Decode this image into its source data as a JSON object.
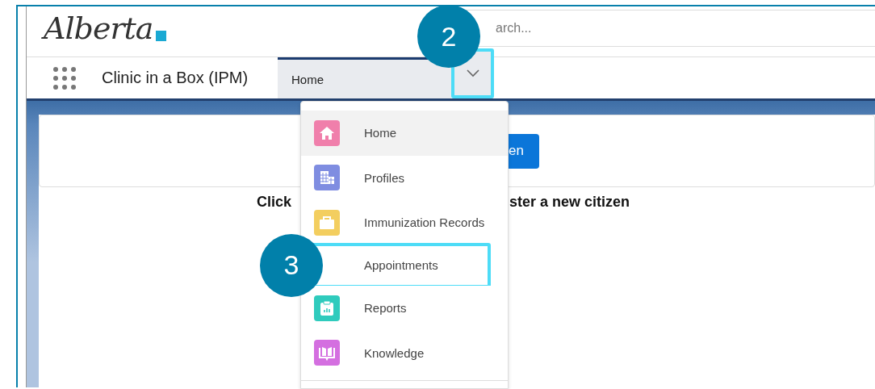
{
  "logo": {
    "text": "Alberta"
  },
  "search": {
    "placeholder": "arch..."
  },
  "nav": {
    "app_name": "Clinic in a Box (IPM)",
    "tab": {
      "label": "Home",
      "selected": true,
      "callout": "2"
    }
  },
  "card": {
    "button": "en"
  },
  "instruction": [
    "Click",
    "ster a new citizen"
  ],
  "menu": {
    "items": [
      {
        "label": "Home",
        "kind": "home",
        "color": "#f07fab",
        "selected": true
      },
      {
        "label": "Profiles",
        "kind": "building",
        "color": "#7f8de1",
        "selected": false
      },
      {
        "label": "Immunization Records",
        "kind": "case",
        "color": "#f3ce5f",
        "selected": false
      },
      {
        "label": "Appointments",
        "selected": false,
        "callout": "3"
      },
      {
        "label": "Reports",
        "kind": "report",
        "color": "#2fcbbd",
        "selected": false
      },
      {
        "label": "Knowledge",
        "kind": "book",
        "color": "#d46fe0",
        "selected": false
      }
    ]
  }
}
